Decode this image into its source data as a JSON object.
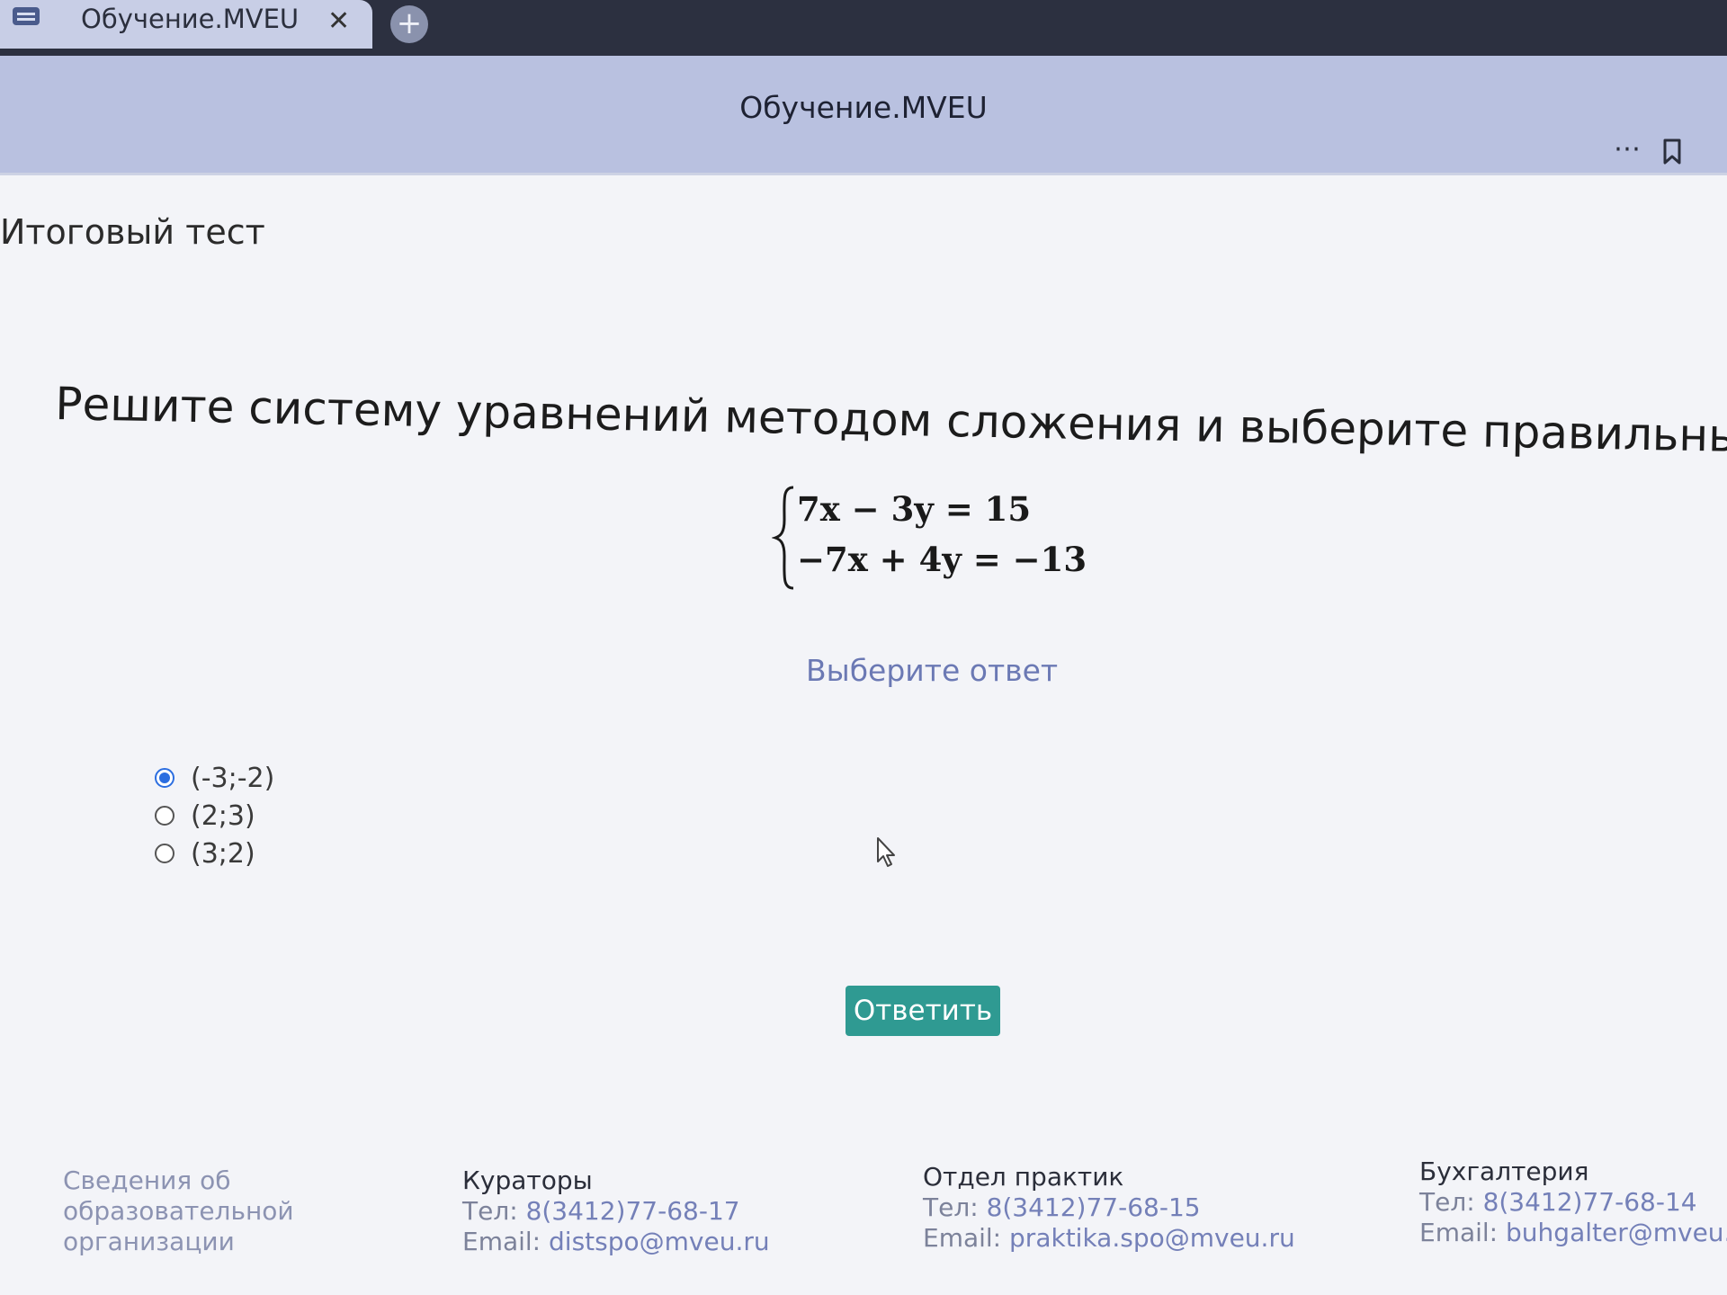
{
  "browser": {
    "tab_title": "Обучение.MVEU",
    "tab_close": "✕",
    "new_tab": "+",
    "site_title": "Обучение.MVEU",
    "more": "⋯"
  },
  "page": {
    "heading": "Итоговый тест",
    "question": "Решите систему уравнений методом сложения и выберите правильный ответ.",
    "equations": [
      "7x − 3y = 15",
      "−7x + 4y = −13"
    ],
    "choose_label": "Выберите ответ",
    "options": [
      {
        "label": "(-3;-2)",
        "checked": true
      },
      {
        "label": "(2;3)",
        "checked": false
      },
      {
        "label": "(3;2)",
        "checked": false
      }
    ],
    "submit_label": "Ответить"
  },
  "footer": {
    "info_lines": [
      "Сведения об",
      "образовательной",
      "организации"
    ],
    "curators": {
      "title": "Кураторы",
      "phone_label": "Тел: ",
      "phone": "8(3412)77-68-17",
      "email_label": "Email: ",
      "email": "distspo@mveu.ru"
    },
    "practice": {
      "title": "Отдел практик",
      "phone_label": "Тел: ",
      "phone": "8(3412)77-68-15",
      "email_label": "Email: ",
      "email": "praktika.spo@mveu.ru"
    },
    "accounting": {
      "title": "Бухгалтерия",
      "phone_label": "Тел: ",
      "phone": "8(3412)77-68-14",
      "email_label": "Email: ",
      "email": "buhgalter@mveu.ru"
    }
  },
  "colors": {
    "accent": "#2f9a92",
    "link": "#7480b8",
    "radio_checked": "#2c6ee0"
  },
  "icons": {
    "favicon": "site-favicon-icon",
    "close": "close-icon",
    "new_tab": "plus-icon",
    "more": "more-dots-icon",
    "bookmark": "bookmark-icon",
    "cursor": "mouse-cursor-icon"
  }
}
